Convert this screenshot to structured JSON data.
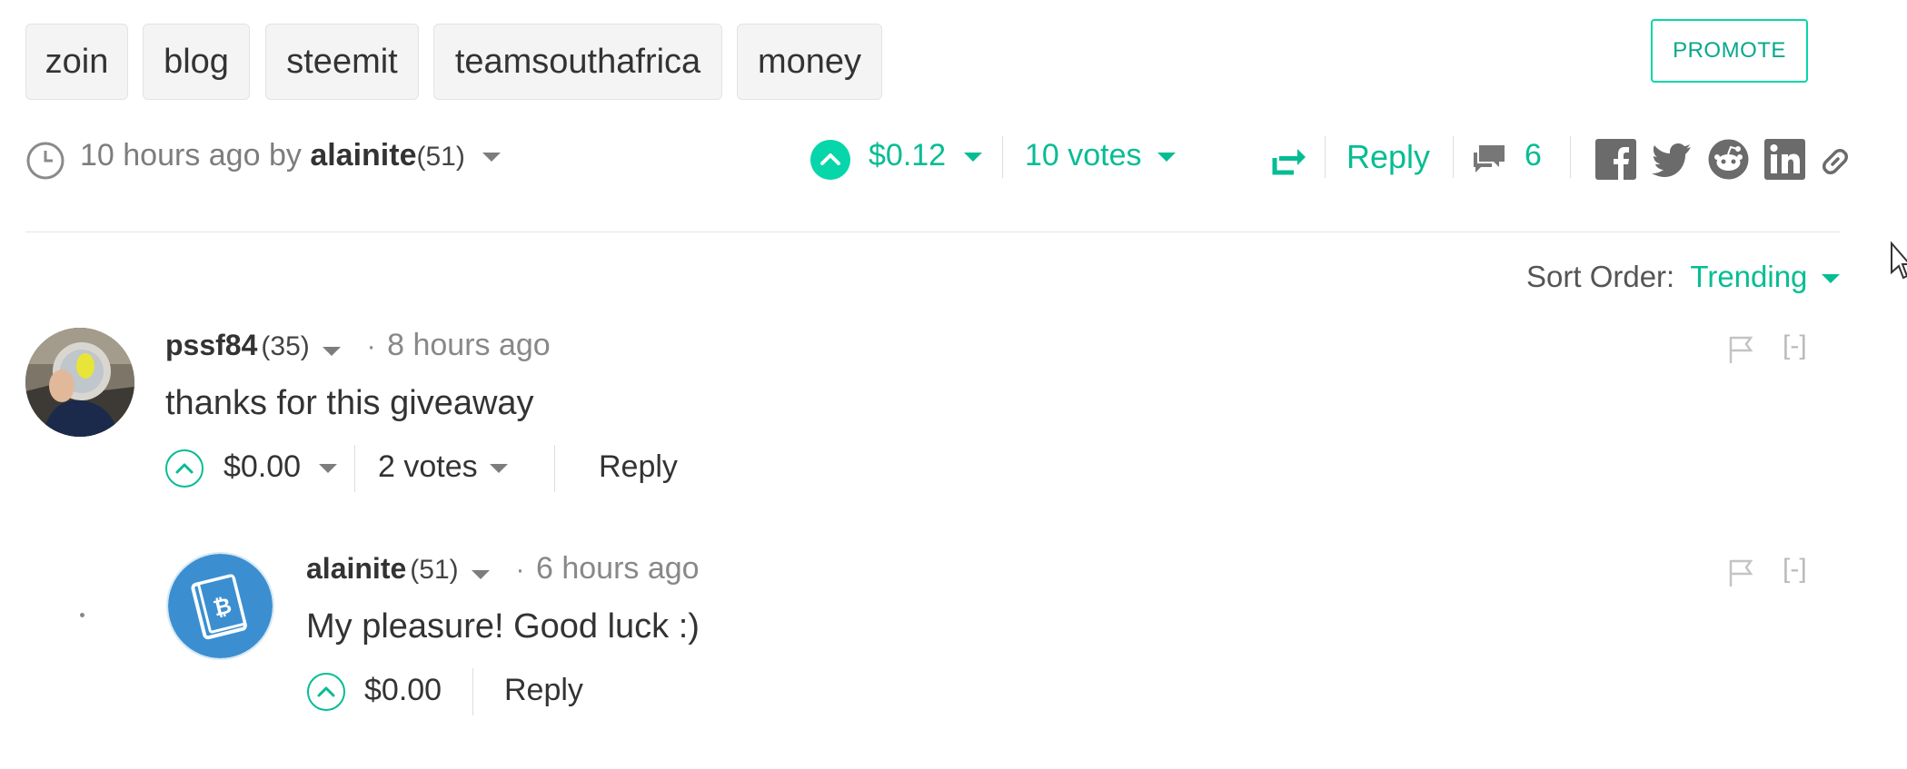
{
  "tags": [
    "zoin",
    "blog",
    "steemit",
    "teamsouthafrica",
    "money"
  ],
  "promote_label": "PROMOTE",
  "post": {
    "time_ago": "10 hours ago",
    "by_label": "by",
    "author": "alainite",
    "reputation": "(51)",
    "payout": "$0.12",
    "votes": "10 votes",
    "reply_label": "Reply",
    "comment_count": "6"
  },
  "sort": {
    "label": "Sort Order:",
    "value": "Trending"
  },
  "comments": [
    {
      "author": "pssf84",
      "reputation": "(35)",
      "time_ago": "8 hours ago",
      "body": "thanks for this giveaway",
      "payout": "$0.00",
      "votes": "2 votes",
      "reply_label": "Reply",
      "collapse_label": "[-]"
    },
    {
      "author": "alainite",
      "reputation": "(51)",
      "time_ago": "6 hours ago",
      "body": "My pleasure! Good luck :)",
      "payout": "$0.00",
      "reply_label": "Reply",
      "collapse_label": "[-]"
    }
  ],
  "colors": {
    "accent": "#06bd93",
    "text": "#333333",
    "muted": "#7d7d7d",
    "avatar_blue": "#3b8fd1"
  },
  "icons": [
    "clock-icon",
    "upvote-icon",
    "resteem-icon",
    "comments-icon",
    "facebook-icon",
    "twitter-icon",
    "reddit-icon",
    "linkedin-icon",
    "link-icon",
    "flag-icon",
    "bitcoin-book-icon"
  ]
}
